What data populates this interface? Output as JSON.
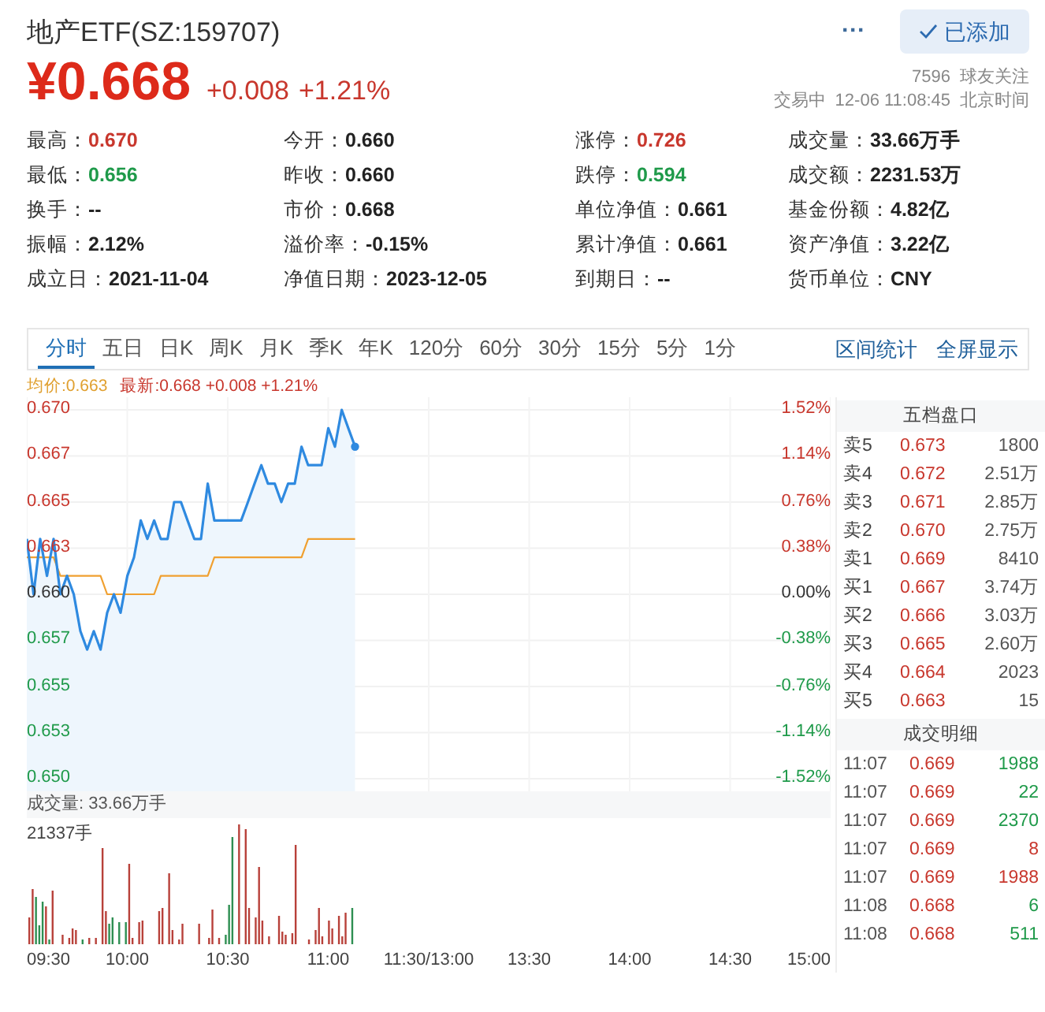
{
  "header": {
    "title": "地产ETF(SZ:159707)",
    "more": "···",
    "follow_button": {
      "label": "已添加",
      "checked": true
    },
    "price": "¥0.668",
    "change": "+0.008",
    "change_pct": "+1.21%",
    "followers": "7596",
    "followers_label": "球友关注",
    "status": "交易中",
    "time": "12-06 11:08:45",
    "timezone": "北京时间"
  },
  "stats": [
    {
      "text": "最高：**0.670**",
      "kind": "up"
    },
    {
      "text": "今开：**0.660**",
      "kind": "plain"
    },
    {
      "text": "涨停：**0.726**",
      "kind": "up"
    },
    {
      "text": "成交量：**33.66万手**",
      "kind": "plain"
    },
    {
      "text": "最低：**0.656**",
      "kind": "down"
    },
    {
      "text": "昨收：**0.660**",
      "kind": "plain"
    },
    {
      "text": "跌停：**0.594**",
      "kind": "down"
    },
    {
      "text": "成交额：**2231.53万**",
      "kind": "plain"
    },
    {
      "text": "换手：**--**",
      "kind": "plain"
    },
    {
      "text": "市价：**0.668**",
      "kind": "plain"
    },
    {
      "text": "单位净值：**0.661**",
      "kind": "plain"
    },
    {
      "text": "基金份额：**4.82亿**",
      "kind": "plain"
    },
    {
      "text": "振幅：**2.12%**",
      "kind": "plain"
    },
    {
      "text": "溢价率：**-0.15%**",
      "kind": "plain"
    },
    {
      "text": "累计净值：**0.661**",
      "kind": "plain"
    },
    {
      "text": "资产净值：**3.22亿**",
      "kind": "plain"
    },
    {
      "text": "成立日：**2021-11-04**",
      "kind": "plain"
    },
    {
      "text": "净值日期：**2023-12-05**",
      "kind": "plain"
    },
    {
      "text": "到期日：**--**",
      "kind": "plain"
    },
    {
      "text": "货币单位：**CNY**",
      "kind": "plain"
    }
  ],
  "tabs": [
    {
      "label": "分时",
      "selected": true
    },
    {
      "label": "五日",
      "selected": false
    },
    {
      "label": "日K",
      "selected": false
    },
    {
      "label": "周K",
      "selected": false
    },
    {
      "label": "月K",
      "selected": false
    },
    {
      "label": "季K",
      "selected": false
    },
    {
      "label": "年K",
      "selected": false
    },
    {
      "label": "120分",
      "selected": false
    },
    {
      "label": "60分",
      "selected": false
    },
    {
      "label": "30分",
      "selected": false
    },
    {
      "label": "15分",
      "selected": false
    },
    {
      "label": "5分",
      "selected": false
    },
    {
      "label": "1分",
      "selected": false
    }
  ],
  "tab_links": [
    "区间统计",
    "全屏显示"
  ],
  "chart": {
    "legend_values": [
      ":0.663",
      ":0.668 +0.008 +1.21%"
    ],
    "time_labels": [
      "09:30",
      "10:00",
      "10:30",
      "11:00",
      "11:30/13:00",
      "13:30",
      "14:00",
      "14:30",
      "15:00"
    ],
    "chart_data": {
      "type": "line",
      "grid": true,
      "ylim": [
        0.65,
        0.67
      ],
      "categories": [
        null,
        null,
        null,
        null,
        null,
        null,
        null,
        null,
        null,
        null,
        null,
        null,
        null,
        null,
        null,
        null,
        null,
        null,
        null,
        null,
        null,
        null,
        null,
        null,
        null,
        null,
        null,
        null,
        null,
        null,
        null,
        null,
        null,
        null,
        null,
        null,
        null,
        null,
        null,
        null,
        null,
        null,
        null,
        null,
        null,
        null,
        null,
        null,
        null,
        null,
        null,
        null,
        null,
        null,
        null,
        null,
        null,
        null,
        null,
        null,
        null,
        null,
        null,
        null,
        null,
        null,
        null,
        null,
        null,
        null,
        null,
        null,
        null,
        null,
        null,
        null,
        null,
        null,
        null,
        null,
        null,
        null,
        null,
        null,
        null,
        null,
        null,
        null,
        null,
        null,
        null,
        null,
        null,
        null,
        null,
        null,
        null,
        null,
        null,
        null,
        null,
        null,
        null,
        null,
        null,
        null,
        null,
        null,
        null,
        null,
        null,
        null,
        null,
        null,
        null,
        null,
        null,
        null,
        null,
        null,
        null
      ],
      "series": [
        {
          "name": "均价",
          "color": "#f0a030",
          "values": [
            0.662,
            0.662,
            0.662,
            0.662,
            0.662,
            0.661,
            0.661,
            0.661,
            0.661,
            0.661,
            0.661,
            0.661,
            0.66,
            0.66,
            0.66,
            0.66,
            0.66,
            0.66,
            0.66,
            0.66,
            0.661,
            0.661,
            0.661,
            0.661,
            0.661,
            0.661,
            0.661,
            0.661,
            0.662,
            0.662,
            0.662,
            0.662,
            0.662,
            0.662,
            0.662,
            0.662,
            0.662,
            0.662,
            0.662,
            0.662,
            0.662,
            0.662,
            0.663,
            0.663,
            0.663,
            0.663,
            0.663,
            0.663,
            0.663,
            0.663,
            null,
            null,
            null,
            null,
            null,
            null,
            null,
            null,
            null,
            null,
            null,
            null,
            null,
            null,
            null,
            null,
            null,
            null,
            null,
            null,
            null,
            null,
            null,
            null,
            null,
            null,
            null,
            null,
            null,
            null,
            null,
            null,
            null,
            null,
            null,
            null,
            null,
            null,
            null,
            null,
            null,
            null,
            null,
            null,
            null,
            null,
            null,
            null,
            null,
            null,
            null,
            null,
            null,
            null,
            null,
            null,
            null,
            null,
            null,
            null,
            null,
            null,
            null,
            null,
            null,
            null,
            null,
            null,
            null,
            null,
            null
          ]
        },
        {
          "name": "最新",
          "color": "#2f8ae0",
          "values": [
            0.663,
            0.66,
            0.663,
            0.661,
            0.663,
            0.66,
            0.661,
            0.66,
            0.658,
            0.657,
            0.658,
            0.657,
            0.659,
            0.66,
            0.659,
            0.661,
            0.662,
            0.664,
            0.663,
            0.664,
            0.663,
            0.663,
            0.665,
            0.665,
            0.664,
            0.663,
            0.663,
            0.666,
            0.664,
            0.664,
            0.664,
            0.664,
            0.664,
            0.665,
            0.666,
            0.667,
            0.666,
            0.666,
            0.665,
            0.666,
            0.666,
            0.668,
            0.667,
            0.667,
            0.667,
            0.669,
            0.668,
            0.67,
            0.669,
            0.668,
            null,
            null,
            null,
            null,
            null,
            null,
            null,
            null,
            null,
            null,
            null,
            null,
            null,
            null,
            null,
            null,
            null,
            null,
            null,
            null,
            null,
            null,
            null,
            null,
            null,
            null,
            null,
            null,
            null,
            null,
            null,
            null,
            null,
            null,
            null,
            null,
            null,
            null,
            null,
            null,
            null,
            null,
            null,
            null,
            null,
            null,
            null,
            null,
            null,
            null,
            null,
            null,
            null,
            null,
            null,
            null,
            null,
            null,
            null,
            null,
            null,
            null,
            null,
            null,
            null,
            null,
            null,
            null,
            null,
            null,
            null
          ]
        }
      ],
      "yticks": [
        {
          "value": 0.67,
          "label": "0.670"
        },
        {
          "value": 0.6675,
          "label": "0.667"
        },
        {
          "value": 0.665,
          "label": "0.665"
        },
        {
          "value": 0.6625,
          "label": "0.663"
        },
        {
          "value": 0.66,
          "label": "0.660"
        },
        {
          "value": 0.6575,
          "label": "0.657"
        },
        {
          "value": 0.655,
          "label": "0.655"
        },
        {
          "value": 0.6525,
          "label": "0.653"
        },
        {
          "value": 0.65,
          "label": "0.650"
        }
      ],
      "y2ticks": [
        "1.52%",
        "1.14%",
        "0.76%",
        "0.38%",
        "0.00%",
        "-0.38%",
        "-0.76%",
        "-1.14%",
        "-1.52%"
      ]
    }
  },
  "volume": {
    "title": "成交量: 33.66万手",
    "max_label": "21337手"
  },
  "order_book": {
    "title": "五档盘口",
    "rows": [
      {
        "label": "卖5",
        "price": "0.673",
        "volume": "1800"
      },
      {
        "label": "卖4",
        "price": "0.672",
        "volume": "2.51万"
      },
      {
        "label": "卖3",
        "price": "0.671",
        "volume": "2.85万"
      },
      {
        "label": "卖2",
        "price": "0.670",
        "volume": "2.75万"
      },
      {
        "label": "卖1",
        "price": "0.669",
        "volume": "8410"
      },
      {
        "label": "买1",
        "price": "0.667",
        "volume": "3.74万"
      },
      {
        "label": "买2",
        "price": "0.666",
        "volume": "3.03万"
      },
      {
        "label": "买3",
        "price": "0.665",
        "volume": "2.60万"
      },
      {
        "label": "买4",
        "price": "0.664",
        "volume": "2023"
      },
      {
        "label": "买5",
        "price": "0.663",
        "volume": "15"
      }
    ]
  },
  "trades": {
    "title": "成交明细",
    "rows": [
      {
        "time": "11:07",
        "price": "0.669",
        "volume": "1988",
        "kind": "sell"
      },
      {
        "time": "11:07",
        "price": "0.669",
        "volume": "22",
        "kind": "sell"
      },
      {
        "time": "11:07",
        "price": "0.669",
        "volume": "2370",
        "kind": "sell"
      },
      {
        "time": "11:07",
        "price": "0.669",
        "volume": "8",
        "kind": "buy"
      },
      {
        "time": "11:07",
        "price": "0.669",
        "volume": "1988",
        "kind": "buy"
      },
      {
        "time": "11:08",
        "price": "0.668",
        "volume": "6",
        "kind": "sell"
      },
      {
        "time": "11:08",
        "price": "0.668",
        "volume": "511",
        "kind": "sell"
      }
    ]
  }
}
